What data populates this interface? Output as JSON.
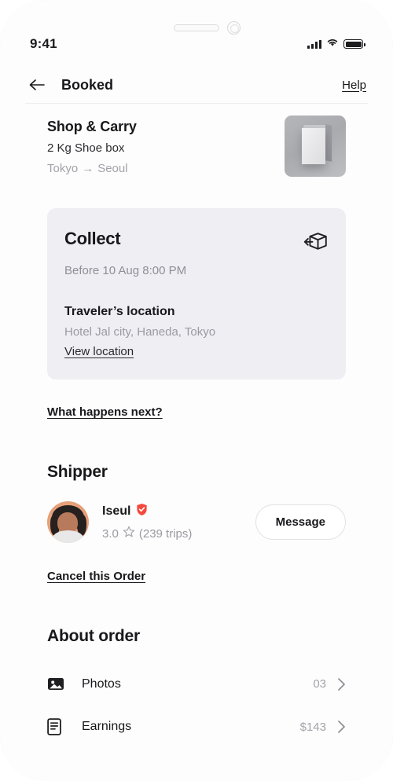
{
  "status_bar": {
    "time": "9:41",
    "signal_icon": "cellular-signal-icon",
    "wifi_icon": "wifi-icon",
    "battery_icon": "battery-full-icon"
  },
  "header": {
    "back_icon": "back-arrow-icon",
    "title": "Booked",
    "help_label": "Help"
  },
  "order_summary": {
    "type": "Shop & Carry",
    "weight": "2 Kg Shoe box",
    "origin": "Tokyo",
    "arrow": "→",
    "destination": "Seoul",
    "thumbnail_icon": "shoe-box-photo"
  },
  "collect_card": {
    "title": "Collect",
    "icon": "package-pickup-icon",
    "deadline": "Before 10 Aug 8:00 PM",
    "traveler_label": "Traveler’s location",
    "traveler_address": "Hotel Jal city, Haneda, Tokyo",
    "view_location_label": "View location",
    "background": "#eeeef3"
  },
  "what_happens_next_label": "What happens next?",
  "shipper": {
    "section_title": "Shipper",
    "name": "Iseul",
    "verified_icon": "verified-shield-icon",
    "verified_color": "#F4483C",
    "rating": "3.0",
    "star_icon": "star-outline-icon",
    "trips": "(239 trips)",
    "message_label": "Message",
    "avatar_icon": "avatar"
  },
  "cancel_order_label": "Cancel this Order",
  "about_order": {
    "section_title": "About order",
    "rows": [
      {
        "icon": "photo-icon",
        "label": "Photos",
        "value": "03",
        "chevron": "chevron-right-icon"
      },
      {
        "icon": "receipt-icon",
        "label": "Earnings",
        "value": "$143",
        "chevron": "chevron-right-icon"
      }
    ]
  }
}
